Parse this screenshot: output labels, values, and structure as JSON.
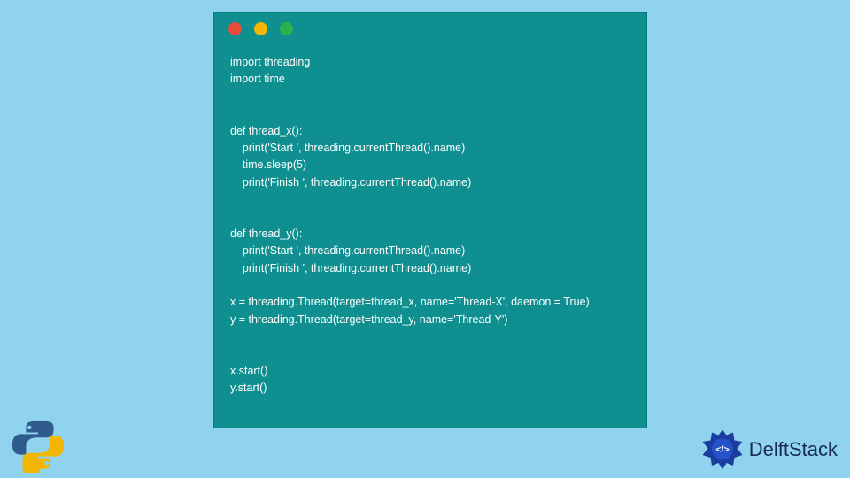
{
  "window": {
    "traffic_lights": [
      "close",
      "minimize",
      "zoom"
    ]
  },
  "code": {
    "lines": [
      "import threading",
      "import time",
      "",
      "",
      "def thread_x():",
      "    print('Start ', threading.currentThread().name)",
      "    time.sleep(5)",
      "    print('Finish ', threading.currentThread().name)",
      "",
      "",
      "def thread_y():",
      "    print('Start ', threading.currentThread().name)",
      "    print('Finish ', threading.currentThread().name)",
      "",
      "x = threading.Thread(target=thread_x, name='Thread-X', daemon = True)",
      "y = threading.Thread(target=thread_y, name='Thread-Y')",
      "",
      "",
      "x.start()",
      "y.start()"
    ]
  },
  "brand": {
    "name": "DelftStack"
  },
  "icons": {
    "python": "python-logo",
    "brand_badge": "delftstack-badge"
  }
}
